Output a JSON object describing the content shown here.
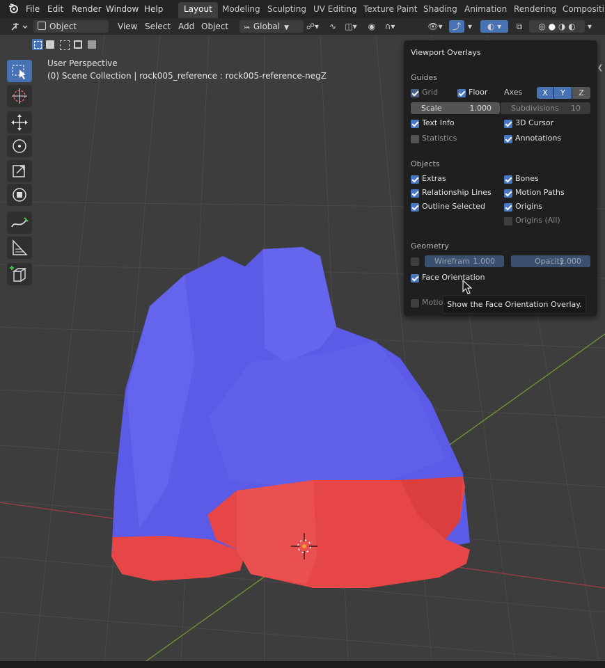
{
  "menu": {
    "file": "File",
    "edit": "Edit",
    "render": "Render",
    "window": "Window",
    "help": "Help"
  },
  "workspaces": [
    "Layout",
    "Modeling",
    "Sculpting",
    "UV Editing",
    "Texture Paint",
    "Shading",
    "Animation",
    "Rendering",
    "Compositing"
  ],
  "header": {
    "mode": "Object Mode",
    "view": "View",
    "select": "Select",
    "add": "Add",
    "object": "Object",
    "orientation": "Global"
  },
  "viewport": {
    "perspective": "User Perspective",
    "collection": "(0) Scene Collection | rock005_reference : rock005-reference-negZ"
  },
  "overlays": {
    "title": "Viewport Overlays",
    "guides": {
      "heading": "Guides",
      "grid": "Grid",
      "floor": "Floor",
      "axes": "Axes",
      "x": "X",
      "y": "Y",
      "z": "Z",
      "scale_label": "Scale",
      "scale_value": "1.000",
      "subdiv_label": "Subdivisions",
      "subdiv_value": "10",
      "text_info": "Text Info",
      "cursor_3d": "3D Cursor",
      "statistics": "Statistics",
      "annotations": "Annotations"
    },
    "objects": {
      "heading": "Objects",
      "extras": "Extras",
      "bones": "Bones",
      "relationship_lines": "Relationship Lines",
      "motion_paths": "Motion Paths",
      "outline_selected": "Outline Selected",
      "origins": "Origins",
      "origins_all": "Origins (All)"
    },
    "geometry": {
      "heading": "Geometry",
      "wireframe_label": "Wirefram",
      "wireframe_value": "1.000",
      "opacity_label": "Opacity",
      "opacity_value": "1.000",
      "face_orientation": "Face Orientation",
      "motion": "Motion"
    }
  },
  "tooltip": "Show the Face Orientation Overlay.",
  "colors": {
    "accent": "#4772b3",
    "front_face": "#5a5ae6",
    "back_face": "#e64646",
    "panel": "#1f1f1f",
    "grid_y": "#6f9a2f",
    "grid_x": "#a03c48"
  }
}
